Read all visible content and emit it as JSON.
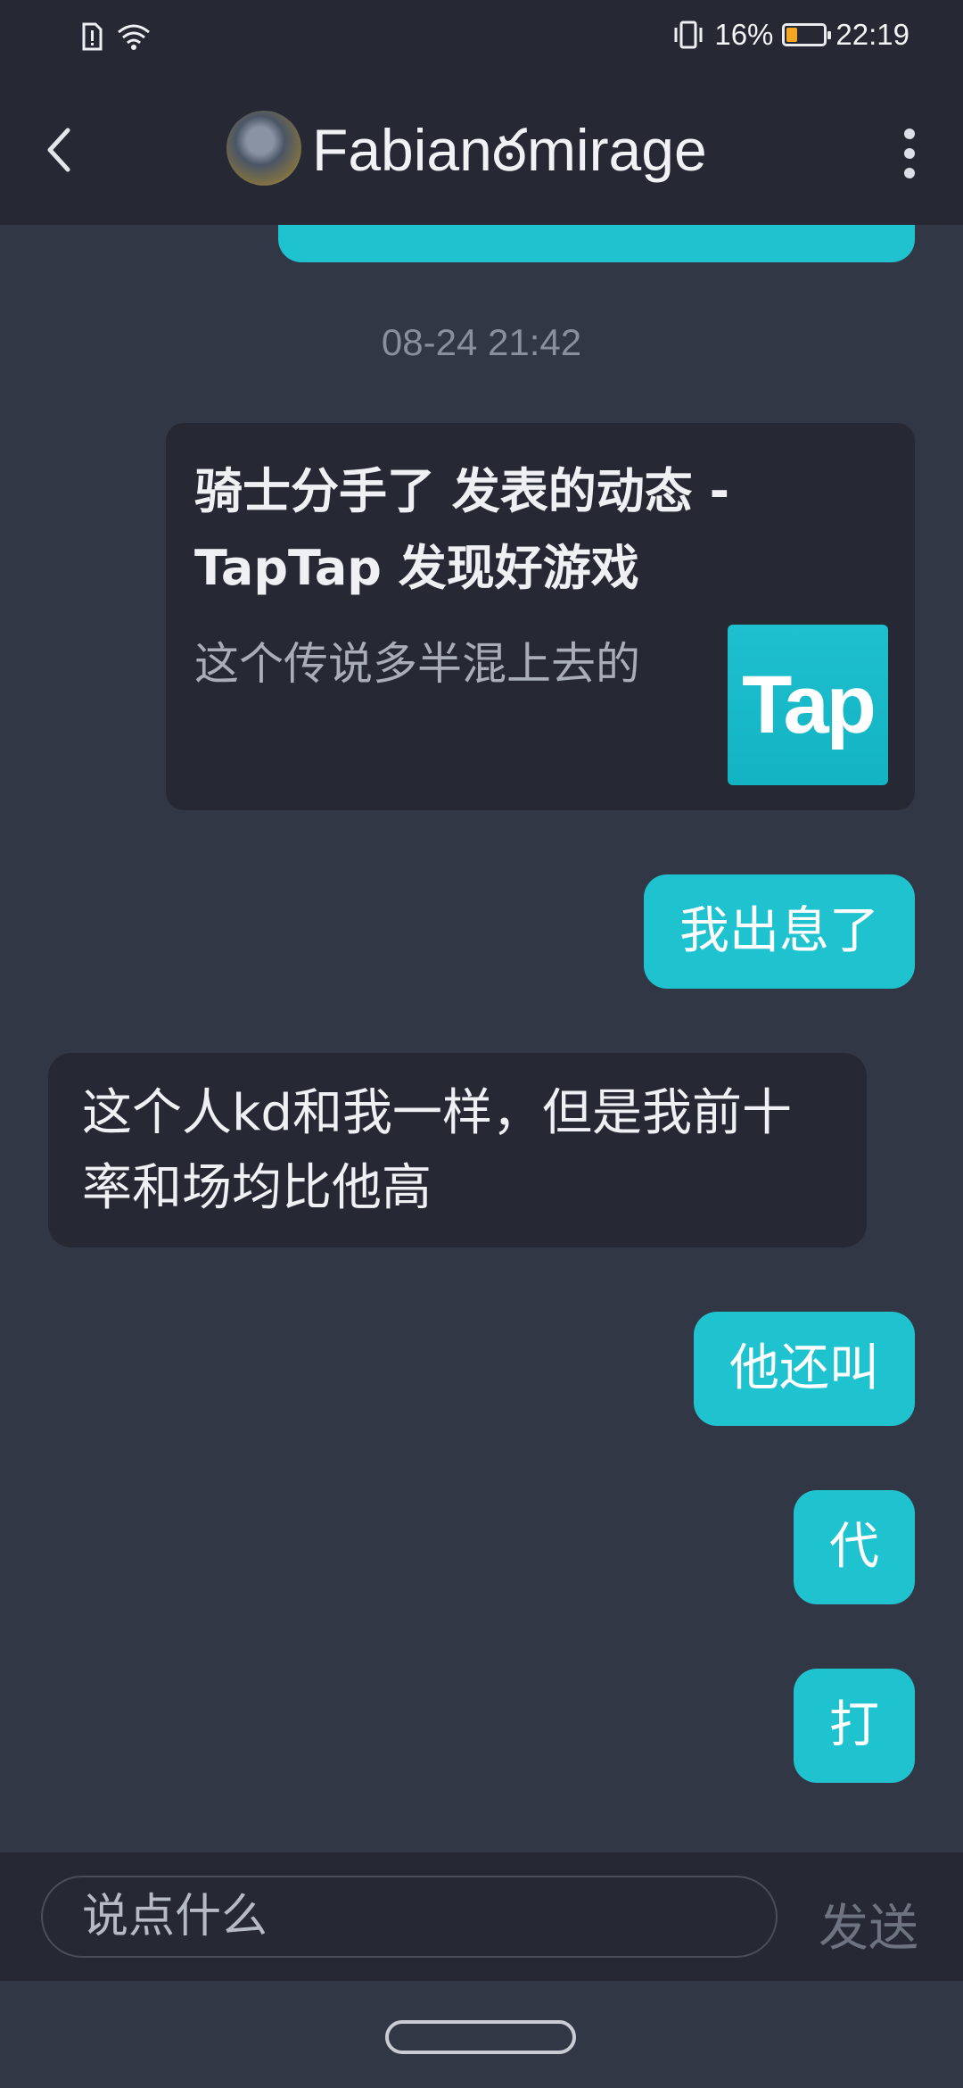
{
  "status_bar": {
    "battery": "16%",
    "time": "22:19",
    "icons": [
      "sim-alert-icon",
      "wifi-icon",
      "vibrate-icon",
      "battery-saver-icon"
    ]
  },
  "header": {
    "title": "Fabianఠmirage",
    "icons": [
      "back-icon",
      "avatar",
      "more-icon"
    ]
  },
  "chat": {
    "timestamp": "08-24 21:42",
    "shared_card": {
      "title": "骑士分手了 发表的动态 - TapTap 发现好游戏",
      "description": "这个传说多半混上去的",
      "logo_text": "Tap"
    },
    "messages": [
      {
        "from": "me",
        "text": "我出息了"
      },
      {
        "from": "them",
        "text": "这个人kd和我一样，但是我前十率和场均比他高"
      },
      {
        "from": "me",
        "text": "他还叫"
      },
      {
        "from": "me",
        "text": "代"
      },
      {
        "from": "me",
        "text": "打"
      }
    ]
  },
  "composer": {
    "placeholder": "说点什么",
    "send_label": "发送"
  },
  "colors": {
    "background": "#323746",
    "bar": "#262933",
    "accent": "#1fc3cf"
  }
}
